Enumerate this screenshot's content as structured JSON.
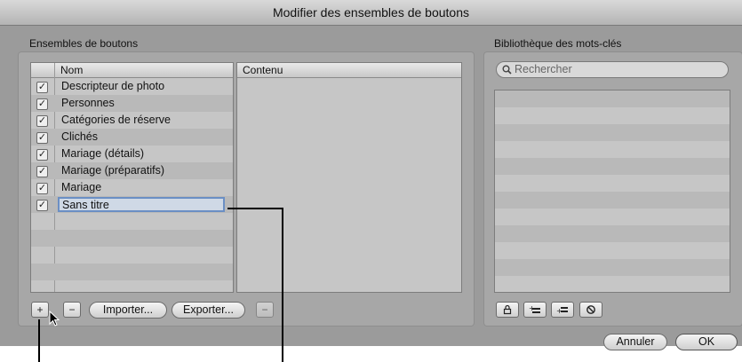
{
  "window": {
    "title": "Modifier des ensembles de boutons"
  },
  "left_section": {
    "label": "Ensembles de boutons",
    "sets_table": {
      "header": "Nom",
      "rows": [
        {
          "label": "Descripteur de photo",
          "checked": true
        },
        {
          "label": "Personnes",
          "checked": true
        },
        {
          "label": "Catégories de réserve",
          "checked": true
        },
        {
          "label": "Clichés",
          "checked": true
        },
        {
          "label": "Mariage (détails)",
          "checked": true
        },
        {
          "label": "Mariage (préparatifs)",
          "checked": true
        },
        {
          "label": "Mariage",
          "checked": true
        },
        {
          "label": "Sans titre",
          "checked": true,
          "editing": true
        }
      ],
      "checkmark": "✓"
    },
    "content_table": {
      "header": "Contenu"
    },
    "buttons": {
      "add": "+",
      "remove": "−",
      "import": "Importer...",
      "export": "Exporter...",
      "remove_content": "−"
    }
  },
  "right_section": {
    "label": "Bibliothèque des mots-clés",
    "search_placeholder": "Rechercher",
    "icon_buttons": [
      "lock-icon",
      "add-keyword-icon",
      "add-subkeyword-icon",
      "remove-keyword-icon"
    ]
  },
  "footer": {
    "cancel": "Annuler",
    "ok": "OK"
  }
}
